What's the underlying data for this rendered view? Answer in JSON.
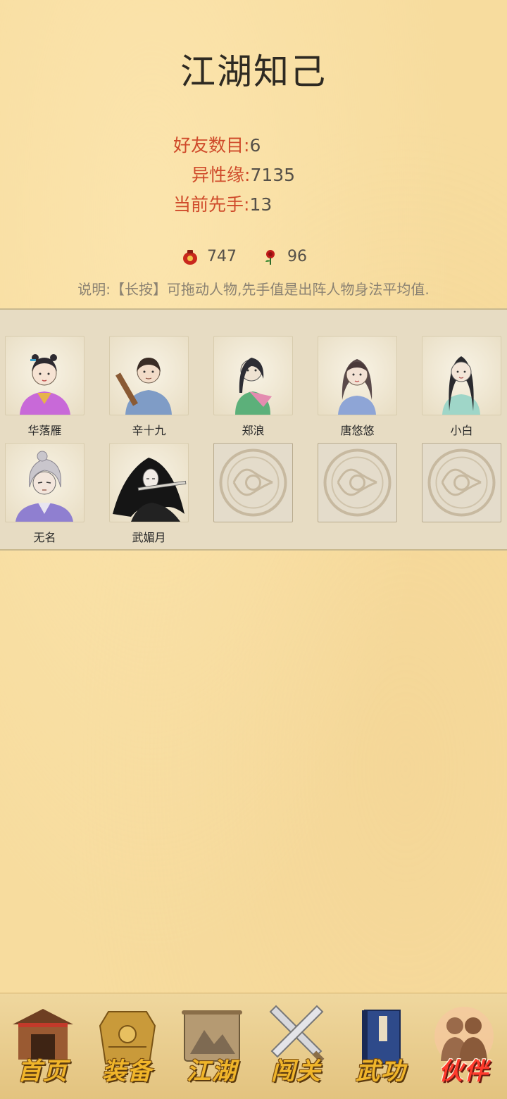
{
  "page": {
    "title": "江湖知己"
  },
  "stats": [
    {
      "label": "好友数目",
      "value": "6"
    },
    {
      "label": "异性缘",
      "value": "7135"
    },
    {
      "label": "当前先手",
      "value": "13"
    }
  ],
  "resources": {
    "wine": {
      "icon": "wine-jar-icon",
      "value": "747"
    },
    "rose": {
      "icon": "rose-icon",
      "value": "96"
    }
  },
  "note": "说明:【长按】可拖动人物,先手值是出阵人物身法平均值.",
  "companions": [
    {
      "name": "华落雁",
      "icon": "portrait-hua-luoyan"
    },
    {
      "name": "辛十九",
      "icon": "portrait-xin-shijiu"
    },
    {
      "name": "郑浪",
      "icon": "portrait-zheng-lang"
    },
    {
      "name": "唐悠悠",
      "icon": "portrait-tang-youyou"
    },
    {
      "name": "小白",
      "icon": "portrait-xiaobai"
    },
    {
      "name": "无名",
      "icon": "portrait-wuming"
    },
    {
      "name": "武媚月",
      "icon": "portrait-wu-meiyue"
    }
  ],
  "empty_slots": 3,
  "nav": [
    {
      "label": "首页",
      "icon": "house-icon"
    },
    {
      "label": "装备",
      "icon": "armor-icon"
    },
    {
      "label": "江湖",
      "icon": "scroll-icon"
    },
    {
      "label": "闯关",
      "icon": "crossed-swords-icon"
    },
    {
      "label": "武功",
      "icon": "book-icon"
    },
    {
      "label": "伙伴",
      "icon": "companions-icon",
      "active": true
    }
  ],
  "colors": {
    "accent": "#cf4a2a",
    "background": "#f7dc9e",
    "panel": "#e7dcc3"
  }
}
